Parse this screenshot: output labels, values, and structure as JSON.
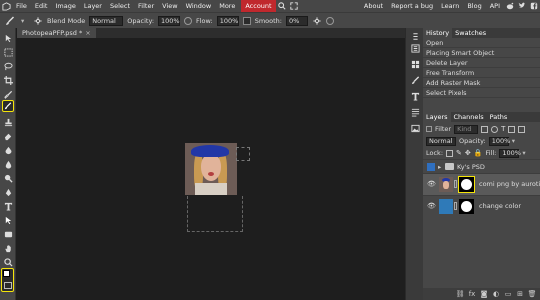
{
  "menu": {
    "items": [
      "File",
      "Edit",
      "Image",
      "Layer",
      "Select",
      "Filter",
      "View",
      "Window",
      "More"
    ],
    "account": "Account",
    "right_links": [
      "About",
      "Report a bug",
      "Learn",
      "Blog",
      "API"
    ]
  },
  "options": {
    "blend_mode_label": "Blend Mode",
    "blend_mode_value": "Normal",
    "opacity_label": "Opacity:",
    "opacity_value": "100%",
    "flow_label": "Flow:",
    "flow_value": "100%",
    "smooth_label": "Smooth:",
    "smooth_value": "0%"
  },
  "document": {
    "tab_title": "PhotopeaPFP.psd *",
    "tab_close": "×"
  },
  "history": {
    "tabs": [
      "History",
      "Swatches"
    ],
    "items": [
      "Open",
      "Placing Smart Object",
      "Delete Layer",
      "Free Transform",
      "Add Raster Mask",
      "Select Pixels"
    ]
  },
  "layers": {
    "tabs": [
      "Layers",
      "Channels",
      "Paths"
    ],
    "filter_label": "Filter",
    "kind_value": "Kind",
    "blend_value": "Normal",
    "opacity_label": "Opacity:",
    "opacity_value": "100%",
    "lock_label": "Lock:",
    "fill_label": "Fill:",
    "fill_value": "100%",
    "group_name": "Ky's PSD",
    "layer1_name": "comi png by aurotinyi",
    "layer2_name": "change color"
  },
  "colors": {
    "accent": "#c0282d",
    "highlight": "#f5e50a",
    "selection_blue": "#2f6fbf"
  }
}
